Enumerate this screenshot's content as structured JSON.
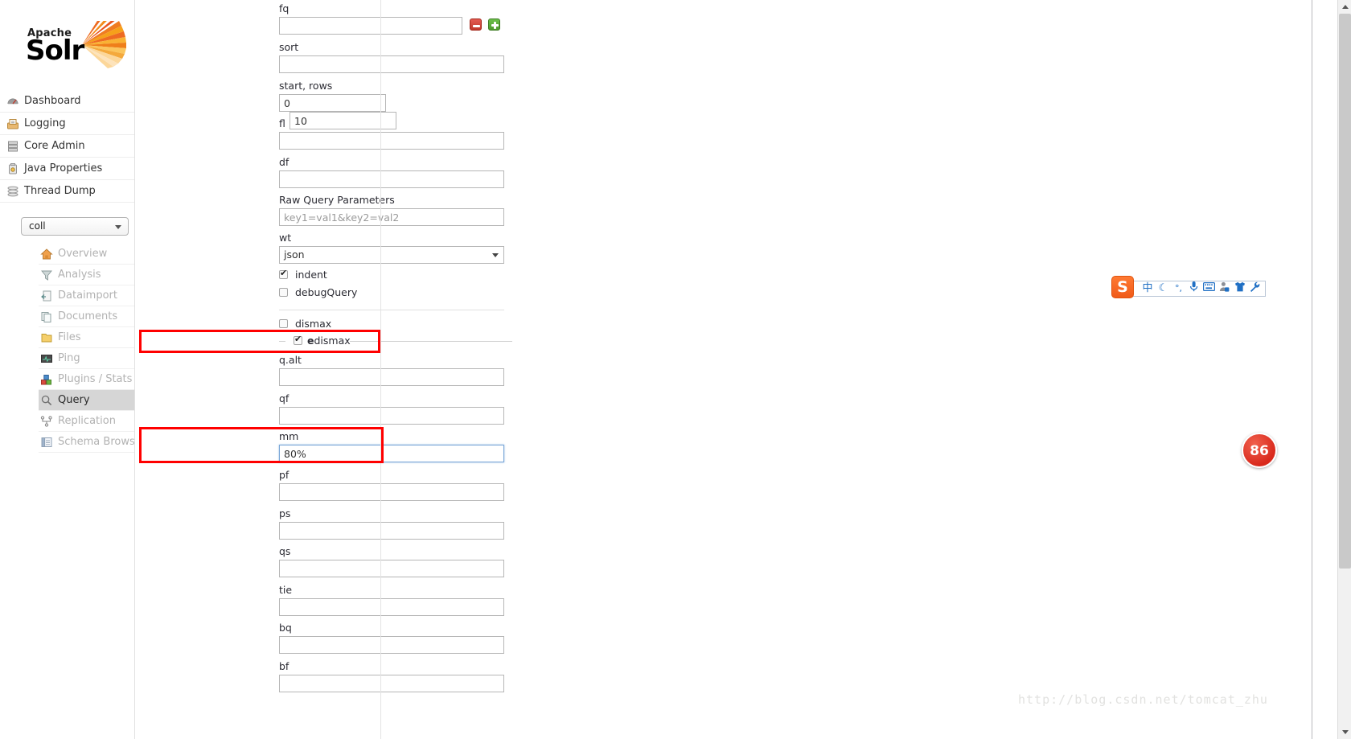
{
  "brand": {
    "apache": "Apache",
    "solr": "Solr"
  },
  "sidebar": {
    "global_items": [
      {
        "label": "Dashboard",
        "icon": "dashboard-icon"
      },
      {
        "label": "Logging",
        "icon": "logging-icon"
      },
      {
        "label": "Core Admin",
        "icon": "core-admin-icon"
      },
      {
        "label": "Java Properties",
        "icon": "java-properties-icon"
      },
      {
        "label": "Thread Dump",
        "icon": "thread-dump-icon"
      }
    ],
    "core_selector": {
      "value": "coll"
    },
    "core_items": [
      {
        "label": "Overview",
        "icon": "home-icon",
        "active": false
      },
      {
        "label": "Analysis",
        "icon": "funnel-icon",
        "active": false
      },
      {
        "label": "Dataimport",
        "icon": "dataimport-icon",
        "active": false
      },
      {
        "label": "Documents",
        "icon": "documents-icon",
        "active": false
      },
      {
        "label": "Files",
        "icon": "folder-icon",
        "active": false
      },
      {
        "label": "Ping",
        "icon": "ping-icon",
        "active": false
      },
      {
        "label": "Plugins / Stats",
        "icon": "plugins-icon",
        "active": false
      },
      {
        "label": "Query",
        "icon": "magnifier-icon",
        "active": true
      },
      {
        "label": "Replication",
        "icon": "replication-icon",
        "active": false
      },
      {
        "label": "Schema Browser",
        "icon": "schema-icon",
        "active": false
      }
    ]
  },
  "query_form": {
    "fq": {
      "label": "fq",
      "value": "",
      "placeholder": ""
    },
    "sort": {
      "label": "sort",
      "value": "",
      "placeholder": ""
    },
    "start_rows": {
      "label": "start, rows",
      "start_value": "0",
      "rows_value": "10"
    },
    "fl": {
      "label": "fl",
      "value": "",
      "placeholder": ""
    },
    "df": {
      "label": "df",
      "value": "",
      "placeholder": ""
    },
    "raw_query_parameters": {
      "label": "Raw Query Parameters",
      "value": "",
      "placeholder": "key1=val1&key2=val2"
    },
    "wt": {
      "label": "wt",
      "selected": "json"
    },
    "indent": {
      "label": "indent",
      "checked": true
    },
    "debug_query": {
      "label": "debugQuery",
      "checked": false
    },
    "dismax": {
      "label": "dismax",
      "checked": false
    },
    "edismax": {
      "label_bold": "e",
      "label_rest": "dismax",
      "checked": true
    },
    "q_alt": {
      "label": "q.alt",
      "value": "",
      "placeholder": ""
    },
    "qf": {
      "label": "qf",
      "value": "",
      "placeholder": ""
    },
    "mm": {
      "label": "mm",
      "value": "80%",
      "placeholder": ""
    },
    "pf": {
      "label": "pf",
      "value": "",
      "placeholder": ""
    },
    "ps": {
      "label": "ps",
      "value": "",
      "placeholder": ""
    },
    "qs": {
      "label": "qs",
      "value": "",
      "placeholder": ""
    },
    "tie": {
      "label": "tie",
      "value": "",
      "placeholder": ""
    },
    "bq": {
      "label": "bq",
      "value": "",
      "placeholder": ""
    },
    "bf": {
      "label": "bf",
      "value": "",
      "placeholder": ""
    },
    "add_button": "add-filter-query",
    "remove_button": "remove-filter-query"
  },
  "annotations": {
    "highlight_color": "#ff0000",
    "boxes": [
      "edismax-highlight",
      "mm-highlight"
    ]
  },
  "ime_toolbar": {
    "logo_text": "S",
    "icons": [
      {
        "name": "chinese-mode-icon",
        "glyph": "中"
      },
      {
        "name": "moon-icon",
        "glyph": "☾"
      },
      {
        "name": "punctuation-icon",
        "glyph": "°,"
      },
      {
        "name": "voice-input-icon",
        "glyph": "🎤"
      },
      {
        "name": "soft-keyboard-icon",
        "glyph": "⌨"
      },
      {
        "name": "user-icon",
        "glyph": "👤"
      },
      {
        "name": "skin-icon",
        "glyph": "👕"
      },
      {
        "name": "toolbox-icon",
        "glyph": "🔧"
      }
    ]
  },
  "badge": {
    "text": "86"
  },
  "watermark": {
    "text": "http://blog.csdn.net/tomcat_zhu"
  },
  "scrollbar": {
    "position_percent": 0
  }
}
